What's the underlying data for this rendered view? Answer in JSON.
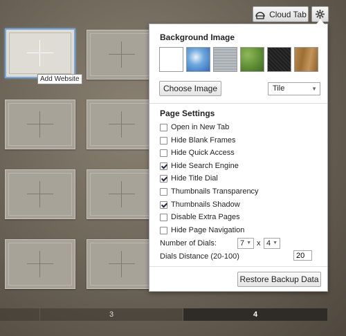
{
  "toolbar": {
    "cloud_tab_label": "Cloud Tab"
  },
  "tooltip": {
    "text": "Add Website"
  },
  "pagination": {
    "pages": [
      "3",
      "4"
    ],
    "active": "4"
  },
  "panel": {
    "background_heading": "Background Image",
    "swatches": [
      "plain-white",
      "blue-sky-clouds",
      "grey-linen",
      "green-leaf-pattern",
      "black-texture",
      "wood-brown"
    ],
    "choose_image_label": "Choose Image",
    "mode_select": "Tile",
    "page_settings_heading": "Page Settings",
    "options": [
      {
        "label": "Open in New Tab",
        "checked": false
      },
      {
        "label": "Hide Blank Frames",
        "checked": false
      },
      {
        "label": "Hide Quick Access",
        "checked": false
      },
      {
        "label": "Hide Search Engine",
        "checked": true
      },
      {
        "label": "Hide Title Dial",
        "checked": true
      },
      {
        "label": "Thumbnails Transparency",
        "checked": false
      },
      {
        "label": "Thumbnails Shadow",
        "checked": true
      },
      {
        "label": "Disable Extra Pages",
        "checked": false
      },
      {
        "label": "Hide Page Navigation",
        "checked": false
      }
    ],
    "dials_label": "Number of Dials:",
    "dials_cols": "7",
    "dials_x": "x",
    "dials_rows": "4",
    "distance_label": "Dials Distance (20-100)",
    "distance_value": "20",
    "restore_label": "Restore Backup Data"
  },
  "colors": {
    "accent_blue": "#7aa7d9",
    "panel_bg": "#ffffff",
    "page_bar_active": "#2f2b26"
  }
}
